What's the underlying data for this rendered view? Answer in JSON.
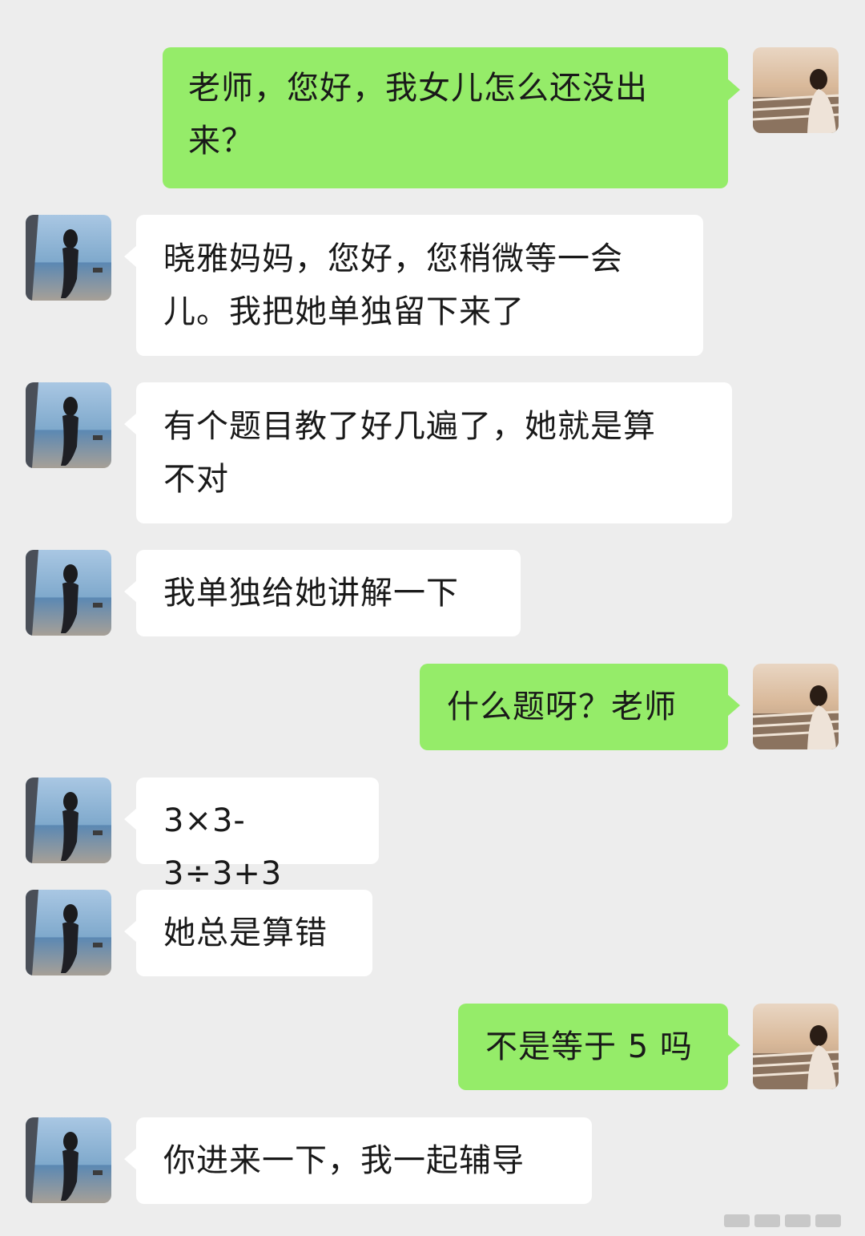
{
  "colors": {
    "background": "#ededed",
    "sent_bubble": "#95ec69",
    "received_bubble": "#ffffff",
    "text": "#191919"
  },
  "contacts": {
    "self_avatar_icon": "woman-by-railing-sunset-avatar-icon",
    "teacher_avatar_icon": "woman-at-beach-avatar-icon"
  },
  "messages": [
    {
      "side": "sent",
      "text": "老师，您好，我女儿怎么还没出\n来？"
    },
    {
      "side": "received",
      "text": "晓雅妈妈，您好，您稍微等一会\n儿。我把她单独留下来了"
    },
    {
      "side": "received",
      "text": "有个题目教了好几遍了，她就是算\n不对"
    },
    {
      "side": "received",
      "text": "我单独给她讲解一下"
    },
    {
      "side": "sent",
      "text": "什么题呀？老师"
    },
    {
      "side": "received",
      "text": "3×3-3÷3+3"
    },
    {
      "side": "received",
      "text": "她总是算错"
    },
    {
      "side": "sent",
      "text": "不是等于 5 吗"
    },
    {
      "side": "received",
      "text": "你进来一下，我一起辅导"
    }
  ]
}
